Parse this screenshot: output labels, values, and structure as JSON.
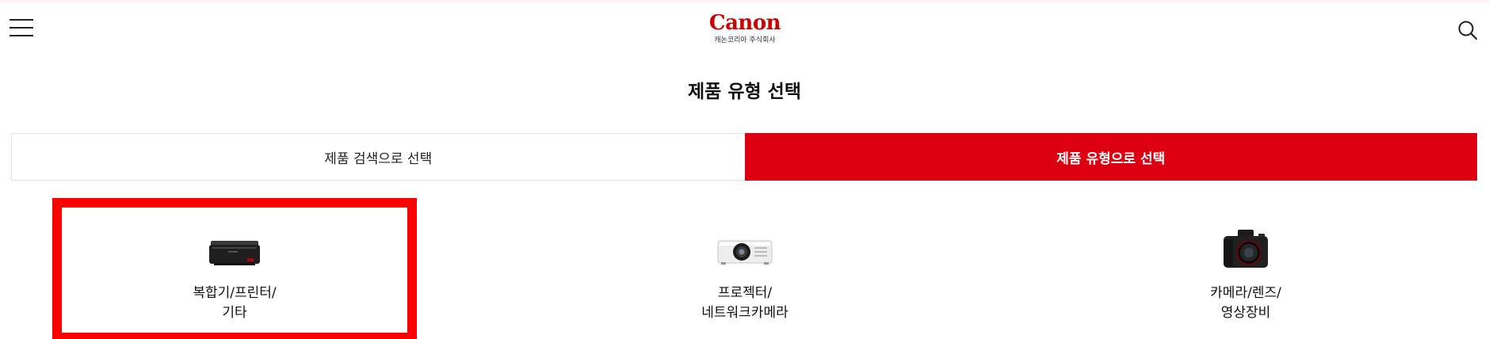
{
  "header": {
    "logo_text": "Canon",
    "logo_subtitle": "캐논코리아 주식회사",
    "menu_icon": "hamburger-menu-icon",
    "search_icon": "search-icon"
  },
  "page": {
    "title": "제품 유형 선택"
  },
  "tabs": [
    {
      "label": "제품 검색으로 선택",
      "active": false
    },
    {
      "label": "제품 유형으로 선택",
      "active": true
    }
  ],
  "products": [
    {
      "line1": "복합기/프린터/",
      "line2": "기타",
      "icon": "printer-icon",
      "highlighted": true
    },
    {
      "line1": "프로젝터/",
      "line2": "네트워크카메라",
      "icon": "projector-icon",
      "highlighted": false
    },
    {
      "line1": "카메라/렌즈/",
      "line2": "영상장비",
      "icon": "camera-icon",
      "highlighted": false
    }
  ],
  "colors": {
    "brand_red": "#cc0000",
    "active_tab": "#dd0010",
    "highlight_border": "#ff0000"
  }
}
